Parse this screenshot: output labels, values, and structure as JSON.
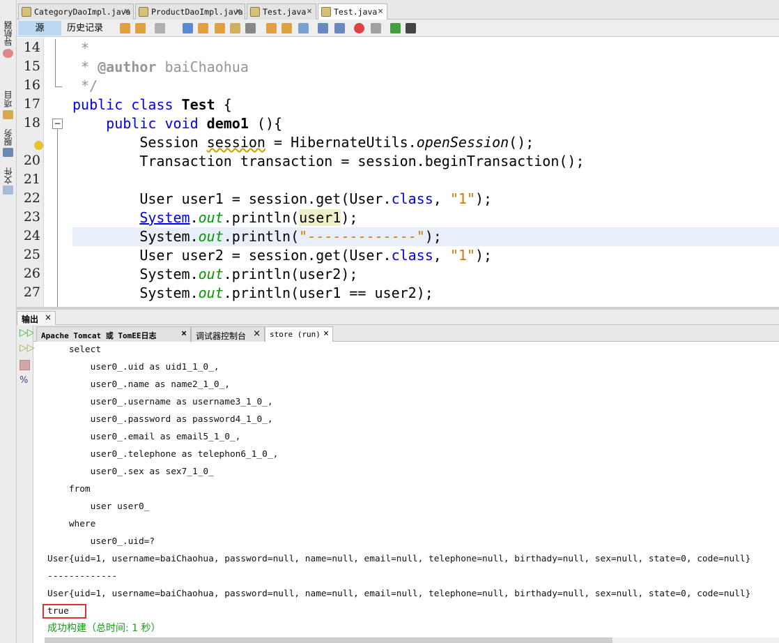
{
  "side_panels": [
    "导航器",
    "项目",
    "服务",
    "文件"
  ],
  "editor_tabs": [
    {
      "label": "CategoryDaoImpl.java",
      "active": false
    },
    {
      "label": "ProductDaoImpl.java",
      "active": false
    },
    {
      "label": "Test.java",
      "active": false
    },
    {
      "label": "Test.java",
      "active": true
    }
  ],
  "toolbar": {
    "source_label": "源",
    "history_label": "历史记录"
  },
  "code": {
    "line_numbers": [
      "14",
      "15",
      "16",
      "17",
      "18",
      "",
      "20",
      "21",
      "22",
      "23",
      "24",
      "25",
      "26",
      "27"
    ],
    "highlighted_line": "24",
    "lines": [
      [
        {
          "t": " *",
          "c": "cm"
        }
      ],
      [
        {
          "t": " * ",
          "c": "cm"
        },
        {
          "t": "@author",
          "c": "cmb"
        },
        {
          "t": " baiChaohua",
          "c": "cm"
        }
      ],
      [
        {
          "t": " */",
          "c": "cm"
        }
      ],
      [
        {
          "t": "public class",
          "c": "kw"
        },
        {
          "t": " "
        },
        {
          "t": "Test",
          "c": "b"
        },
        {
          "t": " {"
        }
      ],
      [
        {
          "t": "    "
        },
        {
          "t": "public void",
          "c": "kw"
        },
        {
          "t": " "
        },
        {
          "t": "demo1",
          "c": "b"
        },
        {
          "t": " (){"
        }
      ],
      [
        {
          "t": "        Session "
        },
        {
          "t": "session",
          "c": "ul"
        },
        {
          "t": " = HibernateUtils."
        },
        {
          "t": "openSession",
          "c": "it"
        },
        {
          "t": "();"
        }
      ],
      [
        {
          "t": "        Transaction transaction = session.beginTransaction();"
        }
      ],
      [
        {
          "t": ""
        }
      ],
      [
        {
          "t": "        User user1 = session.get(User."
        },
        {
          "t": "class",
          "c": "kw"
        },
        {
          "t": ", "
        },
        {
          "t": "\"1\"",
          "c": "str"
        },
        {
          "t": ");"
        }
      ],
      [
        {
          "t": "        "
        },
        {
          "t": "System",
          "c": "lnk"
        },
        {
          "t": "."
        },
        {
          "t": "out",
          "c": "fld"
        },
        {
          "t": ".println("
        },
        {
          "t": "user1",
          "c": "mk"
        },
        {
          "t": ");"
        }
      ],
      [
        {
          "t": "        System."
        },
        {
          "t": "out",
          "c": "fld"
        },
        {
          "t": ".println("
        },
        {
          "t": "\"-------------\"",
          "c": "str"
        },
        {
          "t": ");"
        }
      ],
      [
        {
          "t": "        User user2 = session.get(User."
        },
        {
          "t": "class",
          "c": "kw"
        },
        {
          "t": ", "
        },
        {
          "t": "\"1\"",
          "c": "str"
        },
        {
          "t": ");"
        }
      ],
      [
        {
          "t": "        System."
        },
        {
          "t": "out",
          "c": "fld"
        },
        {
          "t": ".println(user2);"
        }
      ],
      [
        {
          "t": "        System."
        },
        {
          "t": "out",
          "c": "fld"
        },
        {
          "t": ".println(user1 == user2);"
        }
      ]
    ]
  },
  "output": {
    "title": "输出",
    "tabs": [
      {
        "label": "Apache Tomcat 或 TomEE日志",
        "active": false
      },
      {
        "label": "调试器控制台",
        "active": false
      },
      {
        "label": "store (run)",
        "active": true
      }
    ],
    "lines": [
      "    select",
      "        user0_.uid as uid1_1_0_,",
      "        user0_.name as name2_1_0_,",
      "        user0_.username as username3_1_0_,",
      "        user0_.password as password4_1_0_,",
      "        user0_.email as email5_1_0_,",
      "        user0_.telephone as telephon6_1_0_,",
      "        user0_.sex as sex7_1_0_",
      "    from",
      "        user user0_",
      "    where",
      "        user0_.uid=?",
      "User{uid=1, username=baiChaohua, password=null, name=null, email=null, telephone=null, birthady=null, sex=null, state=0, code=null}",
      "-------------",
      "User{uid=1, username=baiChaohua, password=null, name=null, email=null, telephone=null, birthady=null, sex=null, state=0, code=null}",
      "true"
    ],
    "build_status": "成功构建（总时间: 1 秒）"
  },
  "colors": {
    "keyword": "#0000e6",
    "string": "#ce7b00",
    "field": "#009900",
    "success": "#1a9a1a",
    "highlight_box": "#e0303a",
    "current_line": "#e9eff8"
  }
}
